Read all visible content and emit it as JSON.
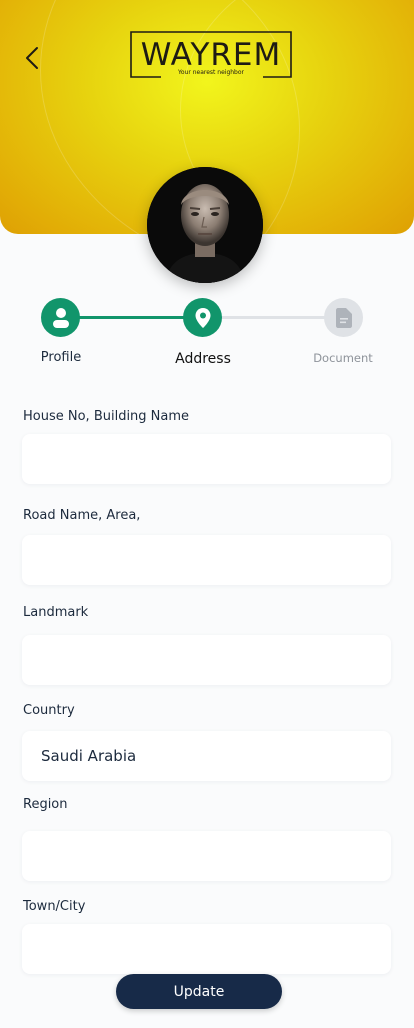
{
  "brand": {
    "name": "WAYREM",
    "tagline": "Your nearest neighbor"
  },
  "stepper": {
    "steps": [
      {
        "label": "Profile",
        "icon": "user-icon",
        "state": "completed"
      },
      {
        "label": "Address",
        "icon": "location-pin-icon",
        "state": "active"
      },
      {
        "label": "Document",
        "icon": "document-icon",
        "state": "pending"
      }
    ]
  },
  "form": {
    "house_label": "House No, Building Name",
    "house_value": "",
    "road_label": "Road Name, Area,",
    "road_value": "",
    "landmark_label": "Landmark",
    "landmark_value": "",
    "country_label": "Country",
    "country_value": "Saudi Arabia",
    "region_label": "Region",
    "region_value": "",
    "city_label": "Town/City",
    "city_value": ""
  },
  "actions": {
    "update_label": "Update"
  },
  "colors": {
    "accent_green": "#11956b",
    "primary_navy": "#172a48",
    "header_yellow": "#e8c80d",
    "pending_gray": "#d9dce1"
  }
}
